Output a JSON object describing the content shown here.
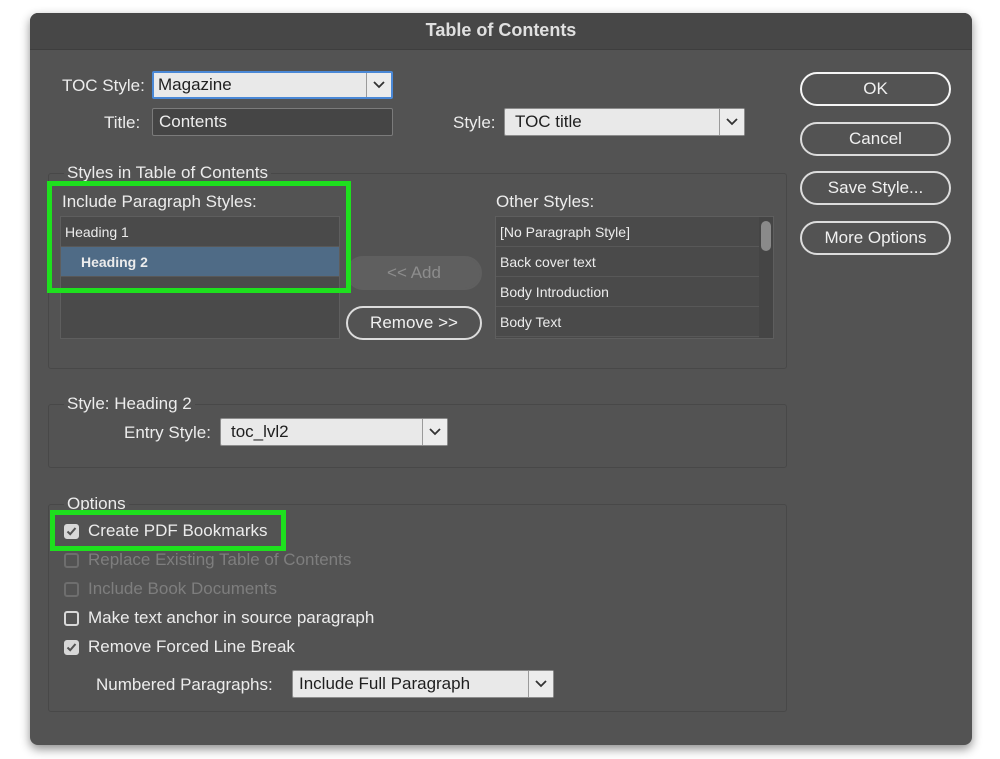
{
  "dialog": {
    "title": "Table of Contents"
  },
  "toc_style": {
    "label": "TOC Style:",
    "value": "Magazine"
  },
  "title_field": {
    "label": "Title:",
    "value": "Contents"
  },
  "title_style": {
    "label": "Style:",
    "value": "TOC title"
  },
  "buttons": {
    "ok": "OK",
    "cancel": "Cancel",
    "save_style": "Save Style...",
    "more_options": "More Options",
    "add": "<< Add",
    "remove": "Remove >>"
  },
  "styles_group": {
    "label": "Styles in Table of Contents",
    "include_label": "Include Paragraph Styles:",
    "include_items": [
      "Heading 1",
      "Heading 2"
    ],
    "other_label": "Other Styles:",
    "other_items": [
      "[No Paragraph Style]",
      "Back cover text",
      "Body Introduction",
      "Body Text"
    ]
  },
  "entry_group": {
    "label": "Style: Heading 2",
    "entry_label": "Entry Style:",
    "entry_value": "toc_lvl2"
  },
  "options_group": {
    "label": "Options",
    "checkboxes": [
      {
        "label": "Create PDF Bookmarks",
        "checked": true,
        "enabled": true
      },
      {
        "label": "Replace Existing Table of Contents",
        "checked": false,
        "enabled": false
      },
      {
        "label": "Include Book Documents",
        "checked": false,
        "enabled": false
      },
      {
        "label": "Make text anchor in source paragraph",
        "checked": false,
        "enabled": true
      },
      {
        "label": "Remove Forced Line Break",
        "checked": true,
        "enabled": true
      }
    ],
    "numbered_label": "Numbered Paragraphs:",
    "numbered_value": "Include Full Paragraph"
  },
  "colors": {
    "dialog_bg": "#535353",
    "highlight": "#1ee01e",
    "selection": "#4f6b86",
    "focus": "#4a88d6"
  },
  "icons": {
    "dropdown": "chevron-down-icon",
    "checkbox": "checkmark-icon"
  }
}
